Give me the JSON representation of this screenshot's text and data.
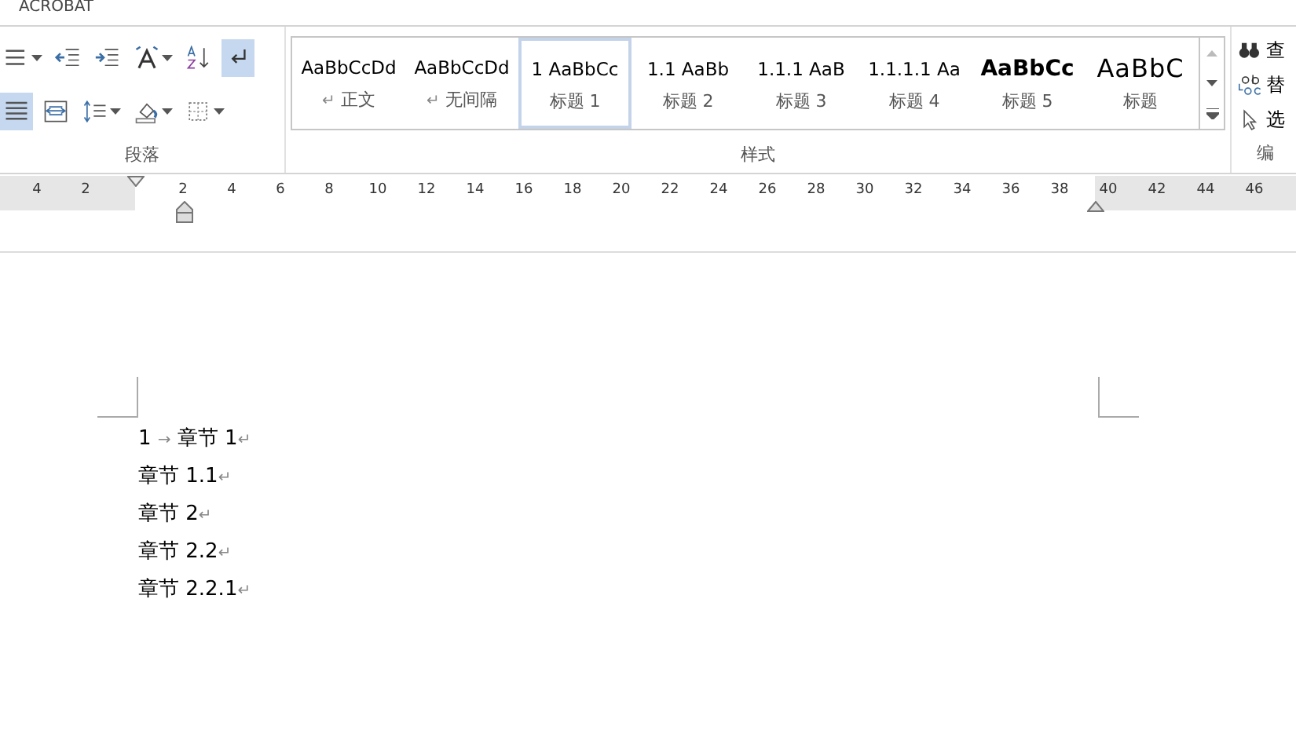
{
  "app_title": "ACROBAT",
  "paragraph_group": {
    "label": "段落",
    "rows": [
      [
        {
          "kind": "bullets",
          "dropdown": true,
          "selected": false
        },
        {
          "kind": "decrease-indent",
          "dropdown": false,
          "selected": false
        },
        {
          "kind": "increase-indent",
          "dropdown": false,
          "selected": false
        },
        {
          "kind": "text-direction",
          "dropdown": true,
          "selected": false
        },
        {
          "kind": "sort",
          "dropdown": false,
          "selected": false
        },
        {
          "kind": "show-marks",
          "dropdown": false,
          "selected": true
        }
      ],
      [
        {
          "kind": "align-edge",
          "dropdown": false,
          "selected": true
        },
        {
          "kind": "distributed",
          "dropdown": false,
          "selected": false
        },
        {
          "kind": "line-spacing",
          "dropdown": true,
          "selected": false
        },
        {
          "kind": "shading",
          "dropdown": true,
          "selected": false
        },
        {
          "kind": "borders",
          "dropdown": true,
          "selected": false
        }
      ]
    ]
  },
  "styles_group": {
    "label": "样式",
    "styles": [
      {
        "preview": "AaBbCcDd",
        "name": "正文",
        "marker": "↵",
        "kind": "normal",
        "selected": false
      },
      {
        "preview": "AaBbCcDd",
        "name": "无间隔",
        "marker": "↵",
        "kind": "normal",
        "selected": false
      },
      {
        "preview": "1 AaBbCc",
        "name": "标题 1",
        "kind": "normal",
        "selected": true
      },
      {
        "preview": "1.1 AaBb",
        "name": "标题 2",
        "kind": "normal",
        "selected": false
      },
      {
        "preview": "1.1.1 AaB",
        "name": "标题 3",
        "kind": "normal",
        "selected": false
      },
      {
        "preview": "1.1.1.1 Aa",
        "name": "标题 4",
        "kind": "normal",
        "selected": false
      },
      {
        "preview": "AaBbCc",
        "name": "标题 5",
        "kind": "bold",
        "selected": false
      },
      {
        "preview": "AaBbC",
        "name": "标题",
        "kind": "title",
        "selected": false
      }
    ]
  },
  "editing_group": {
    "label": "编",
    "items": [
      {
        "kind": "find",
        "label": "查"
      },
      {
        "kind": "replace",
        "label": "替"
      },
      {
        "kind": "select",
        "label": "选"
      }
    ]
  },
  "ruler": {
    "left_numbers": [
      "4",
      "2"
    ],
    "numbers": [
      "2",
      "4",
      "6",
      "8",
      "10",
      "12",
      "14",
      "16",
      "18",
      "20",
      "22",
      "24",
      "26",
      "28",
      "30",
      "32",
      "34",
      "36",
      "38"
    ],
    "right_numbers": [
      "40",
      "42",
      "44",
      "46"
    ]
  },
  "document": {
    "lines": [
      {
        "number": "1",
        "tab_mark": "→",
        "text": "章节 1",
        "mark": "↵"
      },
      {
        "text": "章节 1.1",
        "mark": "↵"
      },
      {
        "text": "章节 2",
        "mark": "↵"
      },
      {
        "text": "章节 2.2",
        "mark": "↵"
      },
      {
        "text": "章节 2.2.1",
        "mark": "↵"
      }
    ]
  }
}
